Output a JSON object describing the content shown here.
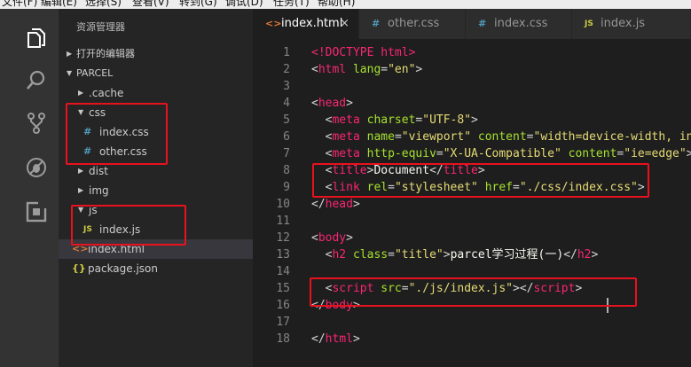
{
  "menu": [
    "文件(F)",
    "编辑(E)",
    "选择(S)",
    "查看(V)",
    "转到(G)",
    "调试(D)",
    "任务(T)",
    "帮助(H)"
  ],
  "activity_bar": [
    "files-icon",
    "search-icon",
    "source-control-icon",
    "debug-icon",
    "extensions-icon"
  ],
  "explorer": {
    "title": "资源管理器",
    "open_editors": "打开的编辑器",
    "project": "PARCEL",
    "tree": [
      {
        "label": ".cache",
        "depth": 1,
        "kind": "folder"
      },
      {
        "label": "css",
        "depth": 1,
        "kind": "folder-open"
      },
      {
        "label": "index.css",
        "depth": 2,
        "kind": "css",
        "icon": "#"
      },
      {
        "label": "other.css",
        "depth": 2,
        "kind": "css",
        "icon": "#"
      },
      {
        "label": "dist",
        "depth": 1,
        "kind": "folder"
      },
      {
        "label": "img",
        "depth": 1,
        "kind": "folder"
      },
      {
        "label": "js",
        "depth": 1,
        "kind": "folder-open"
      },
      {
        "label": "index.js",
        "depth": 2,
        "kind": "js",
        "icon": "JS"
      },
      {
        "label": "index.html",
        "depth": 1,
        "kind": "html",
        "icon": "<>",
        "selected": true
      },
      {
        "label": "package.json",
        "depth": 1,
        "kind": "json",
        "icon": "{}"
      }
    ]
  },
  "tabs": [
    {
      "label": "index.html",
      "icon": "<>",
      "active": true,
      "close": "×"
    },
    {
      "label": "other.css",
      "icon": "#"
    },
    {
      "label": "index.css",
      "icon": "#"
    },
    {
      "label": "index.js",
      "icon": "JS"
    }
  ],
  "code_lines": [
    {
      "n": "1",
      "segs": [
        [
          "tag",
          "<!DOCTYPE html>"
        ]
      ]
    },
    {
      "n": "2",
      "segs": [
        [
          "pun",
          "<"
        ],
        [
          "tag",
          "html"
        ],
        [
          "pun",
          " "
        ],
        [
          "attr",
          "lang"
        ],
        [
          "pun",
          "="
        ],
        [
          "str",
          "\"en\""
        ],
        [
          "pun",
          ">"
        ]
      ]
    },
    {
      "n": "3",
      "segs": []
    },
    {
      "n": "4",
      "segs": [
        [
          "pun",
          "<"
        ],
        [
          "tag",
          "head"
        ],
        [
          "pun",
          ">"
        ]
      ]
    },
    {
      "n": "5",
      "segs": [
        [
          "pun",
          "  <"
        ],
        [
          "tag",
          "meta"
        ],
        [
          "pun",
          " "
        ],
        [
          "attr",
          "charset"
        ],
        [
          "pun",
          "="
        ],
        [
          "str",
          "\"UTF-8\""
        ],
        [
          "pun",
          ">"
        ]
      ]
    },
    {
      "n": "6",
      "segs": [
        [
          "pun",
          "  <"
        ],
        [
          "tag",
          "meta"
        ],
        [
          "pun",
          " "
        ],
        [
          "attr",
          "name"
        ],
        [
          "pun",
          "="
        ],
        [
          "str",
          "\"viewport\""
        ],
        [
          "pun",
          " "
        ],
        [
          "attr",
          "content"
        ],
        [
          "pun",
          "="
        ],
        [
          "str",
          "\"width=device-width, ini"
        ]
      ]
    },
    {
      "n": "7",
      "segs": [
        [
          "pun",
          "  <"
        ],
        [
          "tag",
          "meta"
        ],
        [
          "pun",
          " "
        ],
        [
          "attr",
          "http-equiv"
        ],
        [
          "pun",
          "="
        ],
        [
          "str",
          "\"X-UA-Compatible\""
        ],
        [
          "pun",
          " "
        ],
        [
          "attr",
          "content"
        ],
        [
          "pun",
          "="
        ],
        [
          "str",
          "\"ie=edge\""
        ],
        [
          "pun",
          ">"
        ]
      ]
    },
    {
      "n": "8",
      "segs": [
        [
          "pun",
          "  <"
        ],
        [
          "tag",
          "title"
        ],
        [
          "pun",
          ">"
        ],
        [
          "txt",
          "Document"
        ],
        [
          "pun",
          "</"
        ],
        [
          "tag",
          "title"
        ],
        [
          "pun",
          ">"
        ]
      ]
    },
    {
      "n": "9",
      "segs": [
        [
          "pun",
          "  <"
        ],
        [
          "tag",
          "link"
        ],
        [
          "pun",
          " "
        ],
        [
          "attr",
          "rel"
        ],
        [
          "pun",
          "="
        ],
        [
          "str",
          "\"stylesheet\""
        ],
        [
          "pun",
          " "
        ],
        [
          "attr",
          "href"
        ],
        [
          "pun",
          "="
        ],
        [
          "str",
          "\"./css/index.css\""
        ],
        [
          "pun",
          ">"
        ]
      ]
    },
    {
      "n": "10",
      "segs": [
        [
          "pun",
          "</"
        ],
        [
          "tag",
          "head"
        ],
        [
          "pun",
          ">"
        ]
      ]
    },
    {
      "n": "11",
      "segs": []
    },
    {
      "n": "12",
      "segs": [
        [
          "pun",
          "<"
        ],
        [
          "tag",
          "body"
        ],
        [
          "pun",
          ">"
        ]
      ]
    },
    {
      "n": "13",
      "segs": [
        [
          "pun",
          "  <"
        ],
        [
          "tag",
          "h2"
        ],
        [
          "pun",
          " "
        ],
        [
          "attr",
          "class"
        ],
        [
          "pun",
          "="
        ],
        [
          "str",
          "\"title\""
        ],
        [
          "pun",
          ">"
        ],
        [
          "txt",
          "parcel学习过程(一)"
        ],
        [
          "pun",
          "</"
        ],
        [
          "tag",
          "h2"
        ],
        [
          "pun",
          ">"
        ]
      ]
    },
    {
      "n": "14",
      "segs": []
    },
    {
      "n": "15",
      "segs": [
        [
          "pun",
          "  <"
        ],
        [
          "tag",
          "script"
        ],
        [
          "pun",
          " "
        ],
        [
          "attr",
          "src"
        ],
        [
          "pun",
          "="
        ],
        [
          "str",
          "\"./js/index.js\""
        ],
        [
          "pun",
          "></"
        ],
        [
          "tag",
          "script"
        ],
        [
          "pun",
          ">"
        ]
      ]
    },
    {
      "n": "16",
      "segs": [
        [
          "pun",
          "</"
        ],
        [
          "tag",
          "body"
        ],
        [
          "pun",
          ">"
        ]
      ]
    },
    {
      "n": "17",
      "segs": []
    },
    {
      "n": "18",
      "segs": [
        [
          "pun",
          "</"
        ],
        [
          "tag",
          "html"
        ],
        [
          "pun",
          ">"
        ]
      ]
    }
  ],
  "colors": {
    "highlight": "#e8121e",
    "accent": "#f92672",
    "css_icon": "#519aba",
    "js_icon": "#cbcb41",
    "html_icon": "#e37933",
    "json_icon": "#cbcb41"
  }
}
